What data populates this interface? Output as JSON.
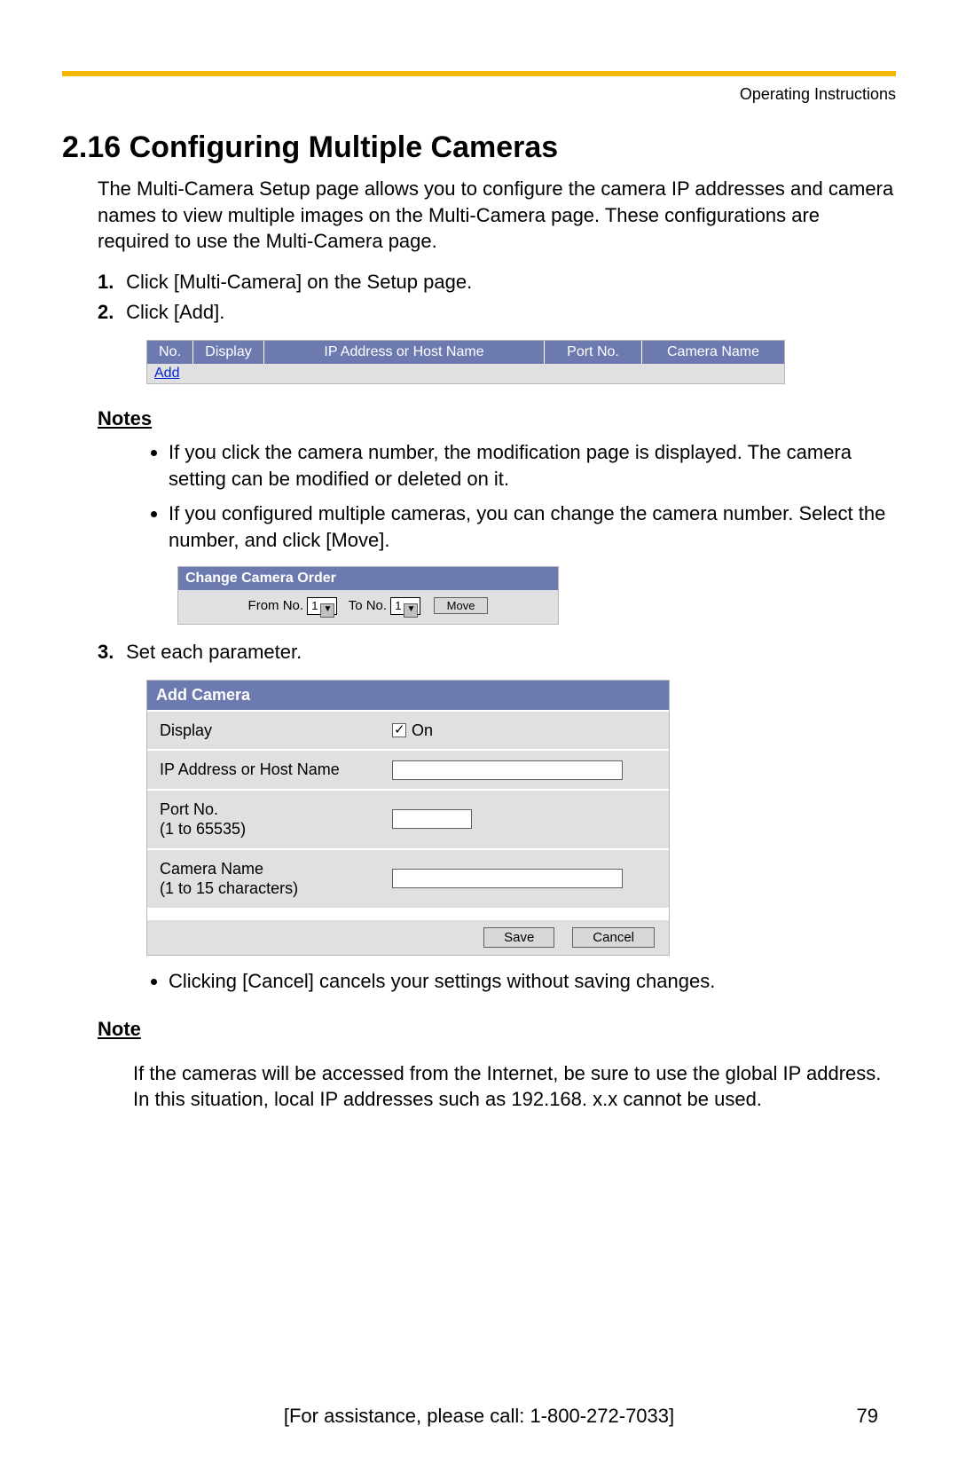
{
  "header": {
    "doc_label": "Operating Instructions"
  },
  "title": "2.16  Configuring Multiple Cameras",
  "intro": "The Multi-Camera Setup page allows you to configure the camera IP addresses and camera names to view multiple images on the Multi-Camera page. These configurations are required to use the Multi-Camera page.",
  "steps": {
    "s1": {
      "num": "1.",
      "text": "Click [Multi-Camera] on the Setup page."
    },
    "s2": {
      "num": "2.",
      "text": "Click [Add]."
    },
    "s3": {
      "num": "3.",
      "text": "Set each parameter."
    }
  },
  "table1": {
    "cols": {
      "no": "No.",
      "display": "Display",
      "ip": "IP Address or Host Name",
      "port": "Port No.",
      "camera": "Camera Name"
    },
    "add_link": "Add"
  },
  "notes_heading": "Notes",
  "notes": {
    "n1": "If you click the camera number, the modification page is displayed. The camera setting can be modified or deleted on it.",
    "n2": "If you configured multiple cameras, you can change the camera number. Select the number, and click [Move]."
  },
  "order_box": {
    "title": "Change Camera Order",
    "from": "From No.",
    "to": "To No.",
    "val_from": "1",
    "val_to": "1",
    "move": "Move"
  },
  "add_panel": {
    "title": "Add Camera",
    "display": "Display",
    "on": "On",
    "ip": "IP Address or Host Name",
    "port": "Port No.",
    "port_hint": "(1 to 65535)",
    "camera": "Camera Name",
    "camera_hint": "(1 to 15 characters)",
    "save": "Save",
    "cancel": "Cancel"
  },
  "cancel_note": "Clicking [Cancel] cancels your settings without saving changes.",
  "note_heading": "Note",
  "note_body": "If the cameras will be accessed from the Internet, be sure to use the global IP address. In this situation, local IP addresses such as 192.168. x.x cannot be used.",
  "footer": {
    "assist": "[For assistance, please call: 1-800-272-7033]",
    "page": "79"
  }
}
